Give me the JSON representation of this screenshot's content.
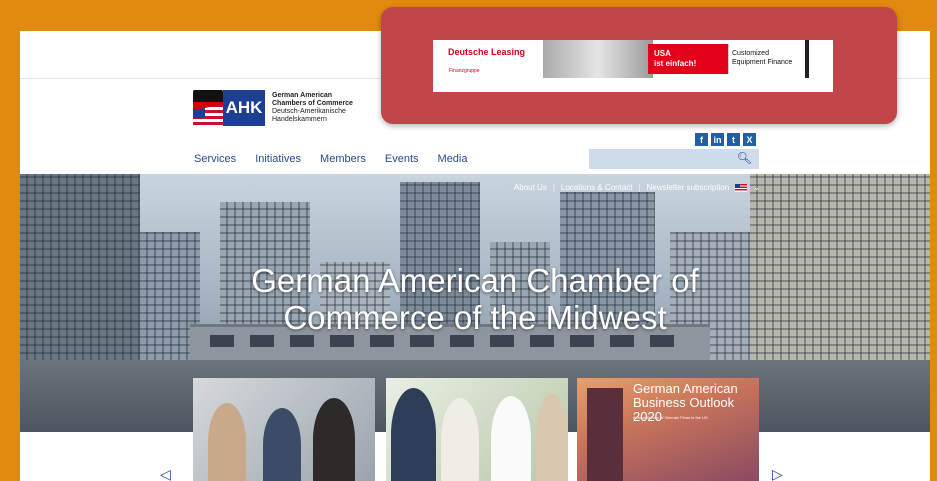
{
  "ad_banner": {
    "brand": "Deutsche Leasing",
    "group": "Finanzgruppe",
    "red_line1": "USA",
    "red_line2": "ist einfach!",
    "offer_line1": "Customized",
    "offer_line2": "Equipment Finance"
  },
  "logo": {
    "mark": "AHK",
    "line1": "German American",
    "line2": "Chambers of Commerce",
    "line3": "Deutsch-Amerikanische",
    "line4": "Handelskammern"
  },
  "social": [
    "f",
    "in",
    "t",
    "X"
  ],
  "nav": [
    "Services",
    "Initiatives",
    "Members",
    "Events",
    "Media"
  ],
  "search": {
    "placeholder": "",
    "icon": "search-icon"
  },
  "utility": [
    "About Us",
    "Locations & Contact",
    "Newsletter subscription"
  ],
  "hero": {
    "title_line1": "German American Chamber of",
    "title_line2": "Commerce of the Midwest"
  },
  "cards": [
    {
      "name": "people-meeting-image"
    },
    {
      "name": "handshake-image"
    },
    {
      "title_line1": "German American",
      "title_line2": "Business Outlook 2020",
      "subtitle": "Annual Survey of German Firms in the US"
    }
  ],
  "carousel": {
    "prev": "◁",
    "next": "▷"
  },
  "colors": {
    "frame": "#e08a10",
    "overlay": "#c0464a",
    "brand": "#1c3f94",
    "nav_text": "#2a4b8d"
  }
}
